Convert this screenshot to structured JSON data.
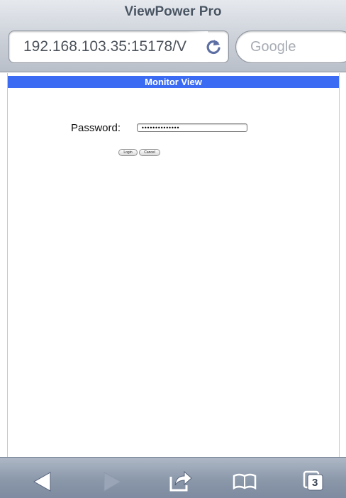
{
  "browser": {
    "page_title": "ViewPower Pro",
    "url": "192.168.103.35:15178/V",
    "search_placeholder": "Google",
    "tab_count": "3"
  },
  "page": {
    "header": "Monitor View",
    "password_label": "Password:",
    "password_value": "••••••••••••••",
    "login_label": "Login",
    "cancel_label": "Cancel"
  },
  "colors": {
    "header_blue": "#3b6bf2",
    "toolbar": "#8b98aa"
  },
  "icons": [
    "back-arrow-icon",
    "forward-arrow-icon",
    "share-icon",
    "bookmarks-icon",
    "tabs-icon",
    "reload-icon"
  ]
}
